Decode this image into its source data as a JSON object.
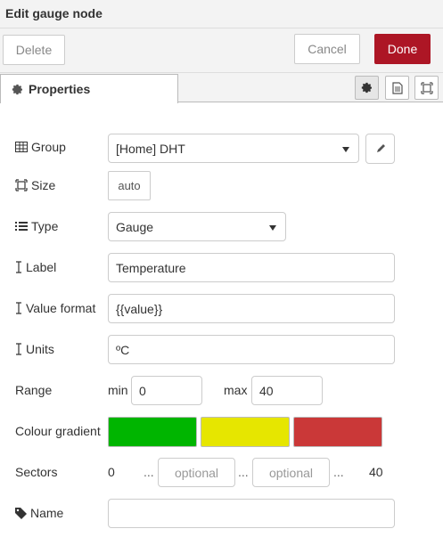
{
  "dialog": {
    "title": "Edit gauge node"
  },
  "toolbar": {
    "delete_label": "Delete",
    "cancel_label": "Cancel",
    "done_label": "Done"
  },
  "tabs": {
    "properties_label": "Properties"
  },
  "form": {
    "group": {
      "label": "Group",
      "value": "[Home] DHT"
    },
    "size": {
      "label": "Size",
      "value": "auto"
    },
    "type": {
      "label": "Type",
      "value": "Gauge"
    },
    "label_field": {
      "label": "Label",
      "value": "Temperature"
    },
    "value_format": {
      "label": "Value format",
      "value": "{{value}}"
    },
    "units": {
      "label": "Units",
      "value": "ºC"
    },
    "range": {
      "label": "Range",
      "min_label": "min",
      "min_value": "0",
      "max_label": "max",
      "max_value": "40"
    },
    "colour_gradient": {
      "label": "Colour gradient",
      "colors": [
        "#00b500",
        "#e6e600",
        "#ca3838"
      ]
    },
    "sectors": {
      "label": "Sectors",
      "start": "0",
      "dots": "...",
      "placeholder_1": "optional",
      "placeholder_2": "optional",
      "end": "40"
    },
    "name": {
      "label": "Name",
      "value": ""
    }
  },
  "icons": {
    "gear": "gear-icon",
    "edit": "pencil-icon",
    "description": "file-icon",
    "appearance": "frame-icon",
    "table": "table-icon",
    "size": "frame-icon",
    "list": "list-icon",
    "cursor": "text-cursor-icon",
    "tag": "tag-icon"
  }
}
